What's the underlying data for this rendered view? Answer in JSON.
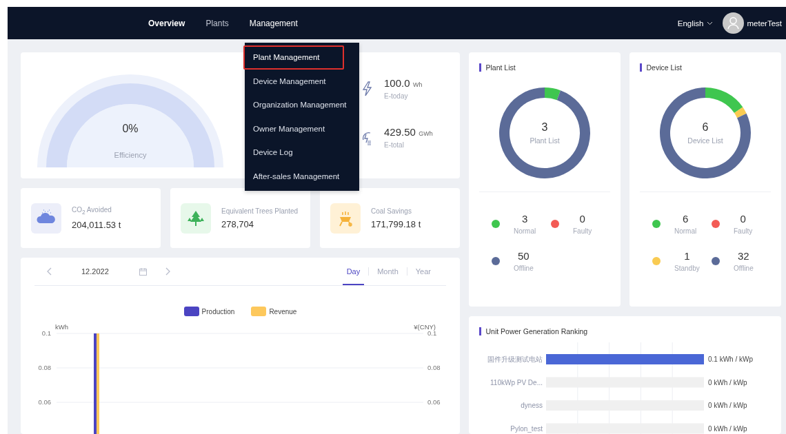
{
  "nav": {
    "items": [
      {
        "label": "Overview",
        "selected": true
      },
      {
        "label": "Plants",
        "selected": false
      },
      {
        "label": "Management",
        "selected": false
      }
    ],
    "language": "English",
    "user": "meterTest"
  },
  "menu": {
    "items": [
      {
        "label": "Plant Management",
        "selected": true
      },
      {
        "label": "Device Management",
        "selected": false
      },
      {
        "label": "Organization Management",
        "selected": false
      },
      {
        "label": "Owner Management",
        "selected": false
      },
      {
        "label": "Device Log",
        "selected": false
      },
      {
        "label": "After-sales Management",
        "selected": false
      }
    ]
  },
  "efficiency": {
    "value": "0%",
    "label": "Efficiency"
  },
  "energy": [
    {
      "value": "100.0",
      "unit": "Wh",
      "label": "E-today",
      "kind": "today"
    },
    {
      "value": "429.50",
      "unit": "GWh",
      "label": "E-total",
      "kind": "total"
    }
  ],
  "savings": [
    {
      "kind": "co2",
      "label": "CO$_{2}$ Avoided",
      "value": "204,011.53 t"
    },
    {
      "kind": "trees",
      "label": "Equivalent Trees Planted",
      "value": "278,704"
    },
    {
      "kind": "coal",
      "label": "Coal Savings",
      "value": "171,799.18 t"
    }
  ],
  "production": {
    "date": "12.2022",
    "periods": [
      {
        "label": "Day",
        "selected": true
      },
      {
        "label": "Month",
        "selected": false
      },
      {
        "label": "Year",
        "selected": false
      }
    ],
    "right_axis": {
      "label": "¥(CNY)",
      "ticks": [
        "0.1",
        "0.08",
        "0.06"
      ]
    },
    "chart_data": {
      "type": "bar",
      "ylabel": "kWh",
      "ylim": [
        0,
        0.1
      ],
      "yticks": [
        0.1,
        0.08,
        0.06
      ],
      "series": [
        {
          "name": "Production",
          "color": "#4b44c2",
          "values": [
            0.1
          ]
        },
        {
          "name": "Revenue",
          "color": "#fdc85c",
          "values": [
            0.1
          ]
        }
      ]
    }
  },
  "lists": [
    {
      "title": "Plant List",
      "total": "3",
      "center_label": "Plant List",
      "stats": [
        {
          "value": "3",
          "label": "Normal",
          "color": "#3fc64f"
        },
        {
          "value": "0",
          "label": "Faulty",
          "color": "#f35b55"
        },
        {
          "value": "50",
          "label": "Offline",
          "color": "#5b6b98"
        }
      ]
    },
    {
      "title": "Device List",
      "total": "6",
      "center_label": "Device List",
      "stats": [
        {
          "value": "6",
          "label": "Normal",
          "color": "#3fc64f"
        },
        {
          "value": "0",
          "label": "Faulty",
          "color": "#f35b55"
        },
        {
          "value": "1",
          "label": "Standby",
          "color": "#f9cb52"
        },
        {
          "value": "32",
          "label": "Offline",
          "color": "#5b6b98"
        }
      ]
    }
  ],
  "ranking": {
    "title": "Unit Power Generation Ranking",
    "chart_data": {
      "type": "bar",
      "orientation": "horizontal",
      "categories": [
        "固件升级测试电站",
        "110kWp PV De...",
        "dyness",
        "Pylon_test"
      ],
      "values": [
        0.1,
        0,
        0,
        0
      ],
      "value_labels": [
        "0.1 kWh / kWp",
        "0 kWh / kWp",
        "0 kWh / kWp",
        "0 kWh / kWp"
      ]
    }
  }
}
